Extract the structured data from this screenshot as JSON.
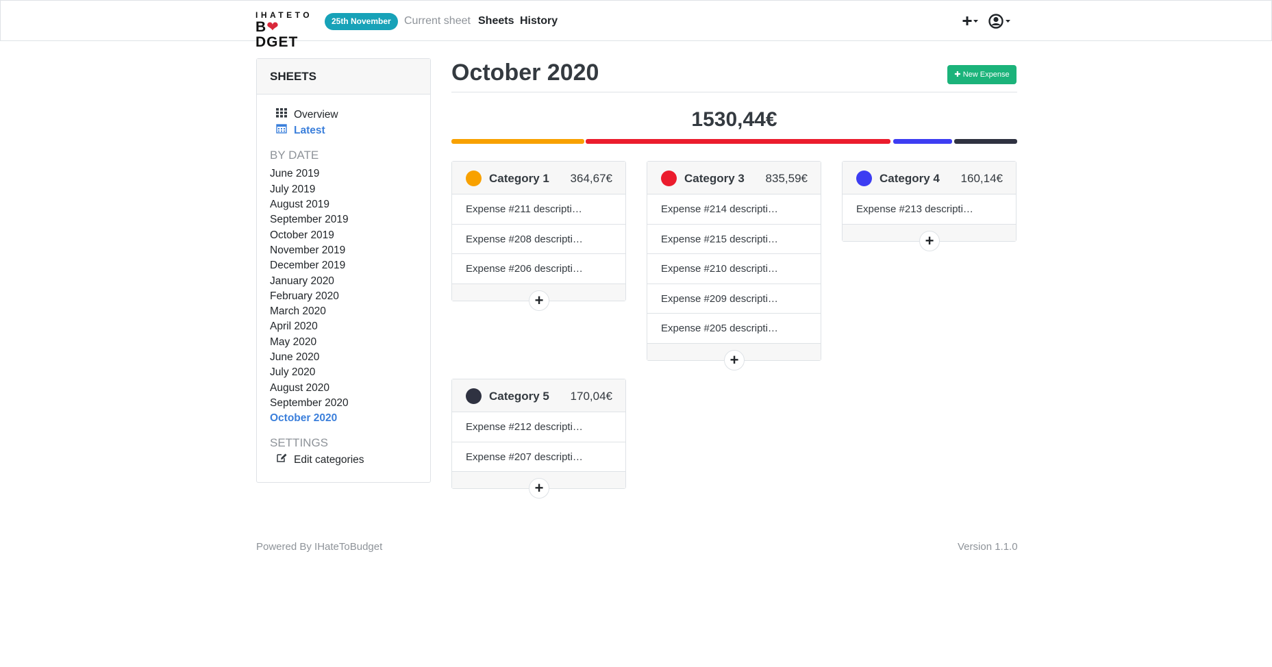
{
  "brand": {
    "top": "IHATETO",
    "bottom_start": "B",
    "bottom_heart": "❤",
    "bottom_end": "DGET"
  },
  "nav": {
    "date_badge": "25th November",
    "links": [
      "Current sheet",
      "Sheets",
      "History"
    ],
    "add_icon": "plus-dropdown-icon",
    "user_icon": "user-circle-icon"
  },
  "sidebar": {
    "header": "SHEETS",
    "overview": "Overview",
    "latest": "Latest",
    "by_date_heading": "BY DATE",
    "months": [
      "June 2019",
      "July 2019",
      "August 2019",
      "September 2019",
      "October 2019",
      "November 2019",
      "December 2019",
      "January 2020",
      "February 2020",
      "March 2020",
      "April 2020",
      "May 2020",
      "June 2020",
      "July 2020",
      "August 2020",
      "September 2020",
      "October 2020"
    ],
    "active_month": "October 2020",
    "settings_heading": "SETTINGS",
    "edit_categories": "Edit categories"
  },
  "main": {
    "title": "October 2020",
    "new_expense_label": "New Expense",
    "total": "1530,44€"
  },
  "colors": {
    "category1": "#f8a100",
    "category3": "#eb1c2d",
    "category4": "#3d3df2",
    "category5": "#2f3241",
    "accent": "#3b7fdb",
    "badge": "#17a2b8",
    "button": "#1bb37a"
  },
  "categories": [
    {
      "name": "Category 1",
      "amount": "364,67€",
      "color": "#f8a100",
      "expenses": [
        "Expense #211 descripti…",
        "Expense #208 descripti…",
        "Expense #206 descripti…"
      ]
    },
    {
      "name": "Category 3",
      "amount": "835,59€",
      "color": "#eb1c2d",
      "expenses": [
        "Expense #214 descripti…",
        "Expense #215 descripti…",
        "Expense #210 descripti…",
        "Expense #209 descripti…",
        "Expense #205 descripti…"
      ]
    },
    {
      "name": "Category 4",
      "amount": "160,14€",
      "color": "#3d3df2",
      "expenses": [
        "Expense #213 descripti…"
      ]
    },
    {
      "name": "Category 5",
      "amount": "170,04€",
      "color": "#2f3241",
      "expenses": [
        "Expense #212 descripti…",
        "Expense #207 descripti…"
      ]
    }
  ],
  "footer": {
    "powered": "Powered By IHateToBudget",
    "version": "Version 1.1.0"
  }
}
